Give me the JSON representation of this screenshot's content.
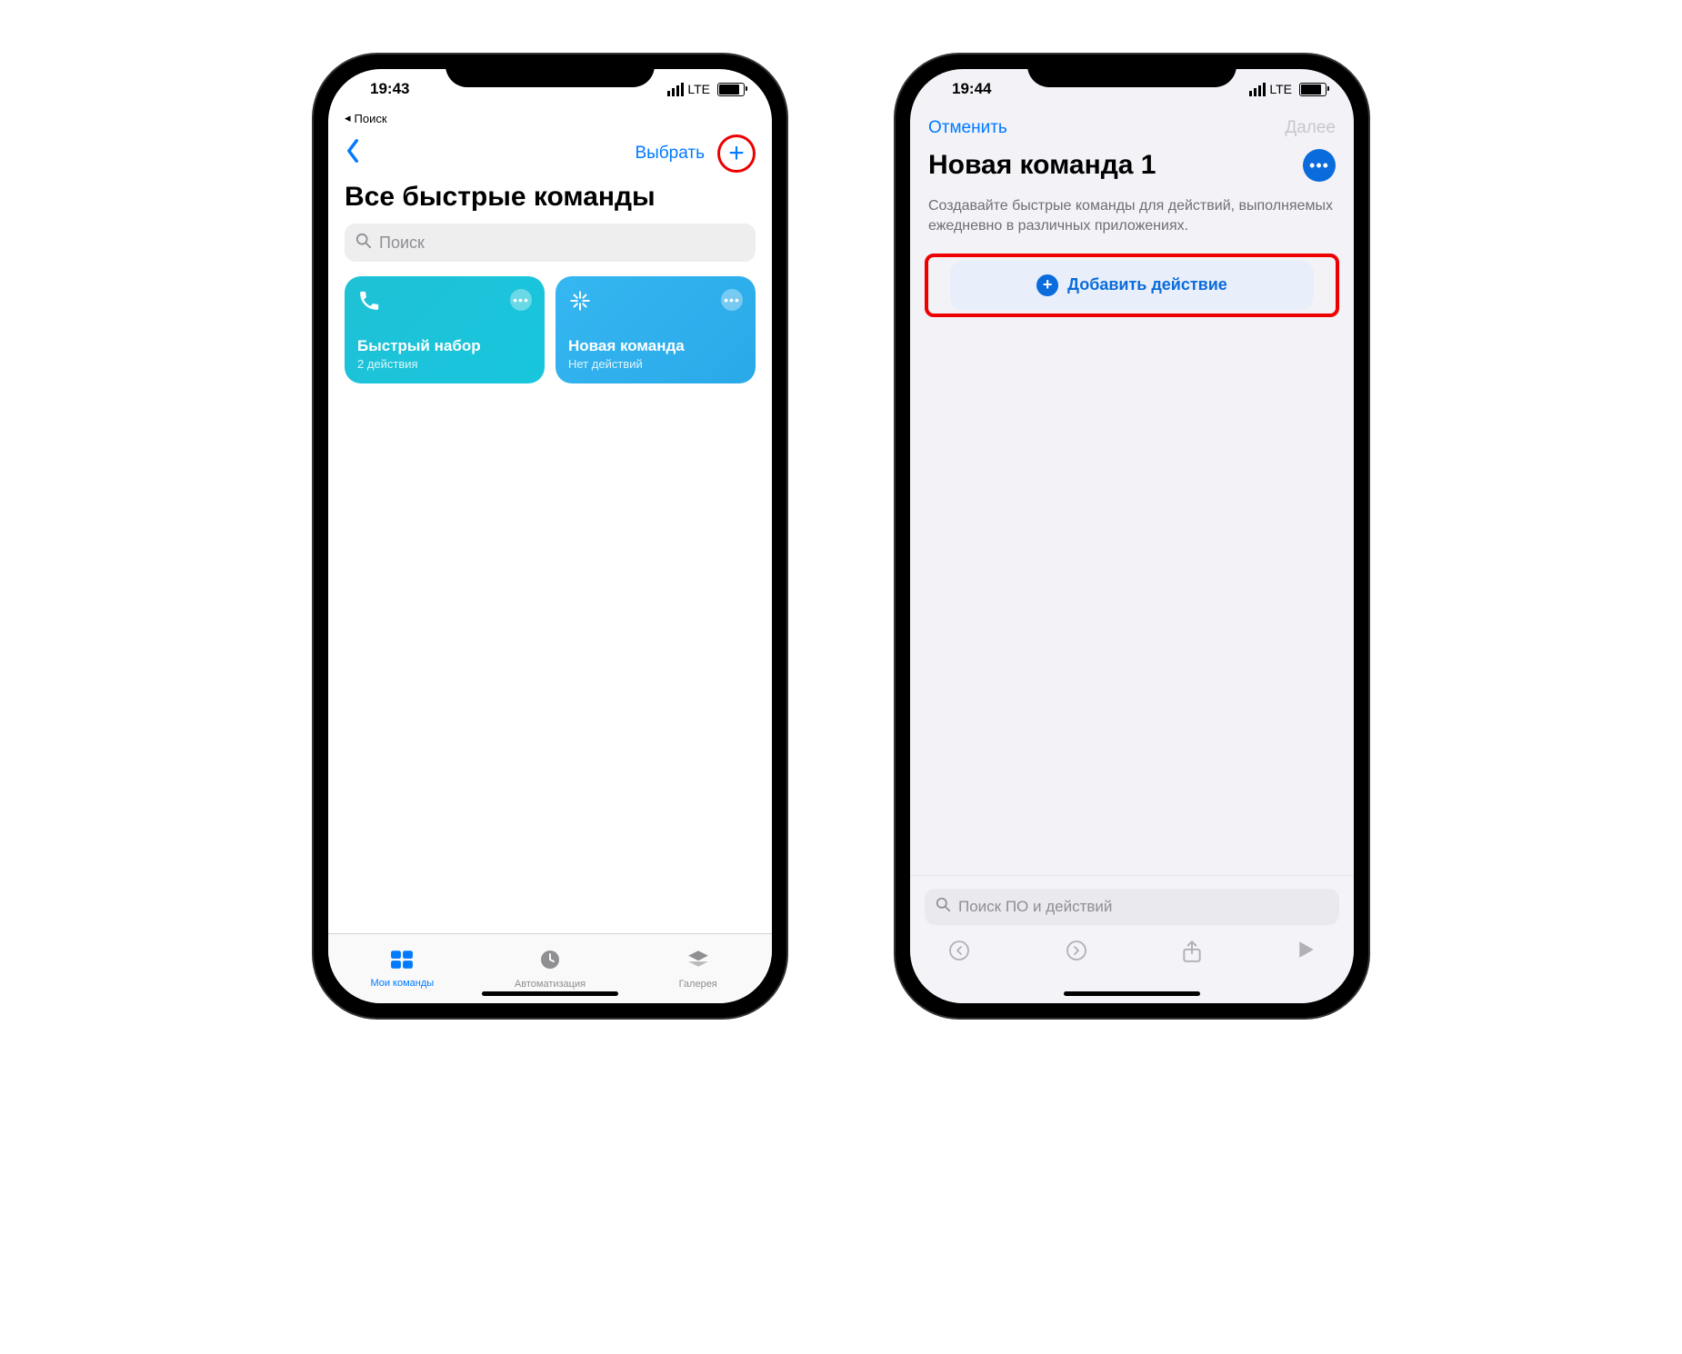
{
  "phone1": {
    "status": {
      "time": "19:43",
      "network": "LTE"
    },
    "breadcrumb": "Поиск",
    "nav": {
      "select_label": "Выбрать"
    },
    "title": "Все быстрые команды",
    "search_placeholder": "Поиск",
    "cards": [
      {
        "title": "Быстрый набор",
        "subtitle": "2 действия"
      },
      {
        "title": "Новая команда",
        "subtitle": "Нет действий"
      }
    ],
    "tabs": {
      "my": "Мои команды",
      "auto": "Автоматизация",
      "gallery": "Галерея"
    }
  },
  "phone2": {
    "status": {
      "time": "19:44",
      "network": "LTE"
    },
    "nav": {
      "cancel": "Отменить",
      "next": "Далее"
    },
    "title": "Новая команда 1",
    "subtitle": "Создавайте быстрые команды для действий, выполняемых ежедневно в различных приложениях.",
    "add_action": "Добавить действие",
    "bottom_search": "Поиск ПО и действий"
  }
}
